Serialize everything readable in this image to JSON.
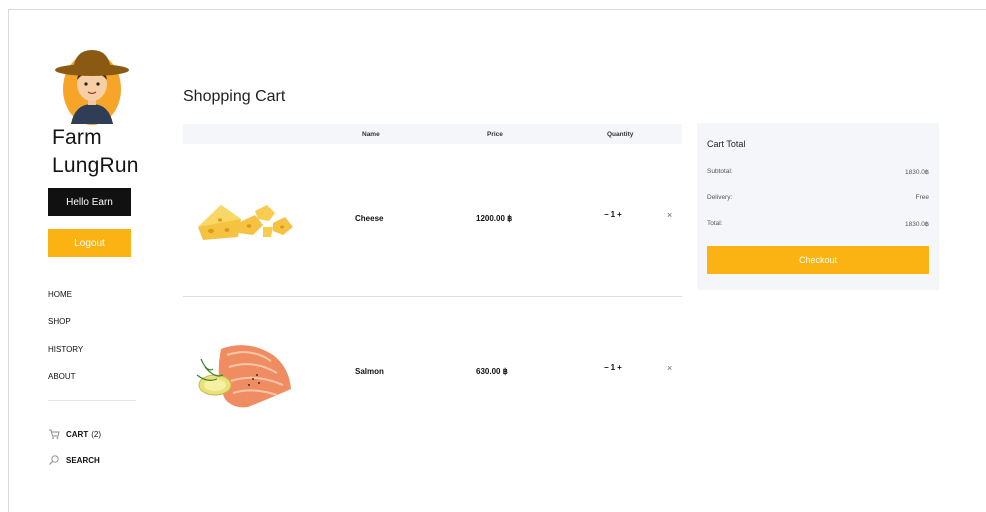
{
  "brand": {
    "line1": "Farm",
    "line2": "LungRun"
  },
  "sidebar": {
    "hello_label": "Hello Earn",
    "logout_label": "Logout",
    "nav": [
      "HOME",
      "SHOP",
      "HISTORY",
      "ABOUT"
    ],
    "cart_label": "CART",
    "cart_count": "(2)",
    "search_label": "SEARCH"
  },
  "main": {
    "title": "Shopping Cart",
    "columns": {
      "name": "Name",
      "price": "Price",
      "quantity": "Quantity"
    },
    "items": [
      {
        "name": "Cheese",
        "price": "1200.00 ฿",
        "qty": "1",
        "minus": "−",
        "plus": "+",
        "remove": "×"
      },
      {
        "name": "Salmon",
        "price": "630.00 ฿",
        "qty": "1",
        "minus": "−",
        "plus": "+",
        "remove": "×"
      }
    ]
  },
  "cart_total": {
    "title": "Cart Total",
    "subtotal_label": "Subtotal:",
    "subtotal_value": "1830.0฿",
    "delivery_label": "Delivery:",
    "delivery_value": "Free",
    "total_label": "Total:",
    "total_value": "1830.0฿",
    "checkout_label": "Checkout"
  },
  "colors": {
    "accent": "#fbb313",
    "dark": "#111111",
    "panel": "#f4f6f9"
  }
}
